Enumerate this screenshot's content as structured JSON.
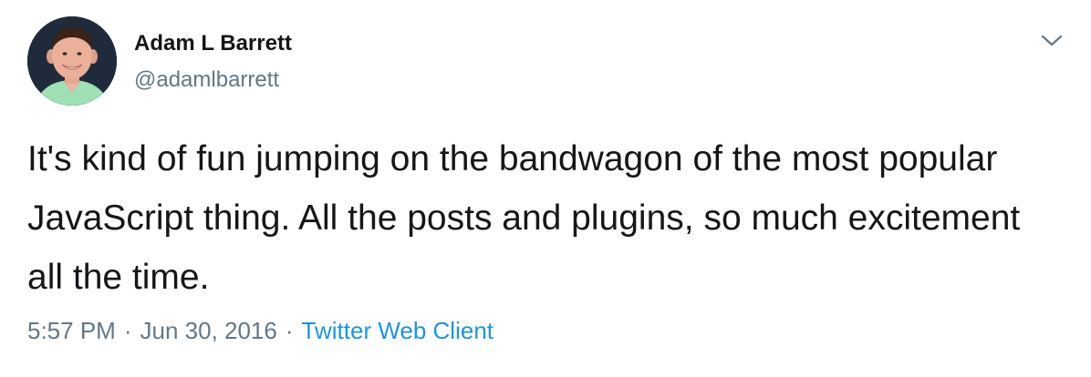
{
  "author": {
    "name": "Adam L Barrett",
    "handle": "@adamlbarrett"
  },
  "tweet": {
    "text": "It's kind of fun jumping on the bandwagon of the most popular JavaScript thing. All the posts and plugins, so much excitement all the time.",
    "time": "5:57 PM",
    "date": "Jun 30, 2016",
    "separator": "·",
    "client": "Twitter Web Client"
  },
  "icons": {
    "menu": "chevron-down-icon"
  },
  "colors": {
    "text": "#14171a",
    "secondary": "#657786",
    "link": "#1b95e0"
  }
}
